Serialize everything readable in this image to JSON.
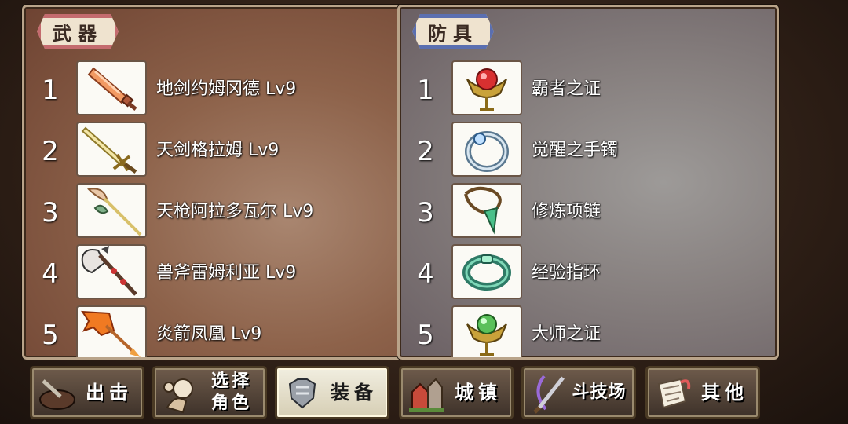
{
  "weapons": {
    "title": "武器",
    "items": [
      {
        "num": "1",
        "name": "地剑约姆冈德 Lv9",
        "icon": "orange-dagger-icon"
      },
      {
        "num": "2",
        "name": "天剑格拉姆 Lv9",
        "icon": "golden-sword-icon"
      },
      {
        "num": "3",
        "name": "天枪阿拉多瓦尔 Lv9",
        "icon": "spear-icon"
      },
      {
        "num": "4",
        "name": "兽斧雷姆利亚 Lv9",
        "icon": "battle-axe-icon"
      },
      {
        "num": "5",
        "name": "炎箭凤凰 Lv9",
        "icon": "flame-arrow-icon"
      }
    ]
  },
  "armor": {
    "title": "防具",
    "items": [
      {
        "num": "1",
        "name": "霸者之证",
        "icon": "red-gem-emblem-icon"
      },
      {
        "num": "2",
        "name": "觉醒之手镯",
        "icon": "silver-bracelet-icon"
      },
      {
        "num": "3",
        "name": "修炼项链",
        "icon": "green-necklace-icon"
      },
      {
        "num": "4",
        "name": "经验指环",
        "icon": "jade-ring-icon"
      },
      {
        "num": "5",
        "name": "大师之证",
        "icon": "green-gem-emblem-icon"
      }
    ]
  },
  "nav": {
    "sortie": "出击",
    "select_line1": "选择",
    "select_line2": "角色",
    "equip": "装备",
    "town": "城镇",
    "arena": "斗技场",
    "other": "其他"
  }
}
